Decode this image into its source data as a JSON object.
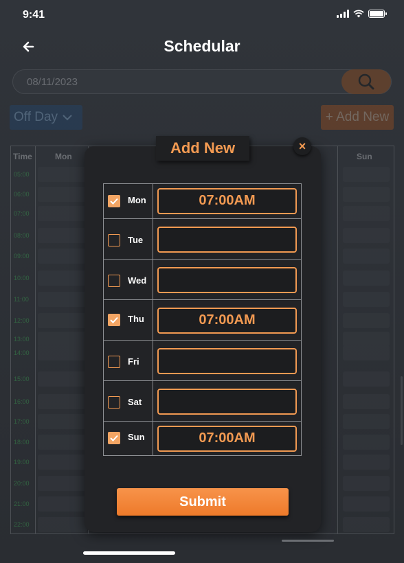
{
  "status_bar": {
    "time": "9:41"
  },
  "header": {
    "title": "Schedular"
  },
  "search": {
    "value": "08/11/2023"
  },
  "filter": {
    "selected": "Off Day"
  },
  "toolbar": {
    "add_new_label": "+ Add New"
  },
  "grid": {
    "headers": {
      "time": "Time",
      "mon": "Mon",
      "sun": "Sun"
    },
    "times": [
      "05:00",
      "06:00",
      "07:00",
      "08:00",
      "09:00",
      "10:00",
      "11:00",
      "12:00",
      "13:00",
      "14:00",
      "15:00",
      "16:00",
      "17:00",
      "18:00",
      "19:00",
      "20:00",
      "21:00",
      "22:00"
    ]
  },
  "modal": {
    "title": "Add New",
    "close_glyph": "×",
    "submit_label": "Submit",
    "days": [
      {
        "name": "Mon",
        "checked": true,
        "time": "07:00AM"
      },
      {
        "name": "Tue",
        "checked": false,
        "time": ""
      },
      {
        "name": "Wed",
        "checked": false,
        "time": ""
      },
      {
        "name": "Thu",
        "checked": true,
        "time": "07:00AM"
      },
      {
        "name": "Fri",
        "checked": false,
        "time": ""
      },
      {
        "name": "Sat",
        "checked": false,
        "time": ""
      },
      {
        "name": "Sun",
        "checked": true,
        "time": "07:00AM"
      }
    ]
  },
  "colors": {
    "accent": "#f29a52",
    "time_label": "#3ec45a",
    "filter_bg": "#1f4b7a"
  }
}
